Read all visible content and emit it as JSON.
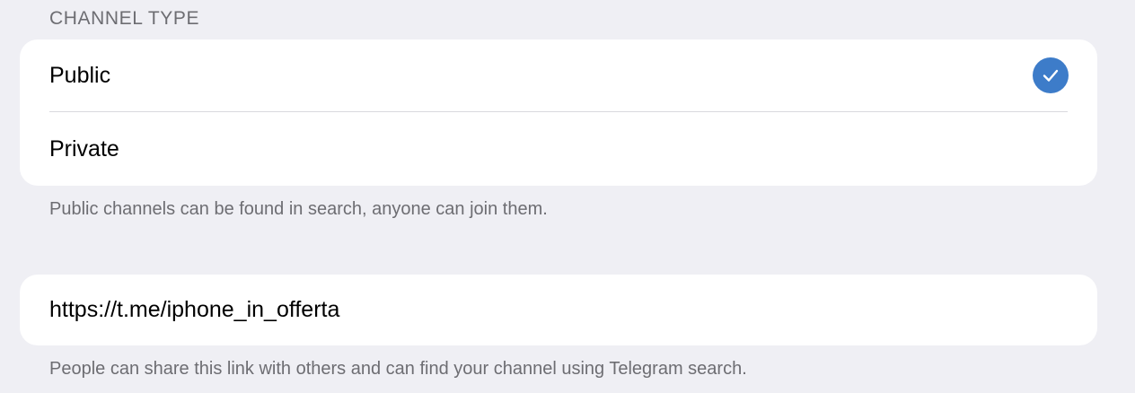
{
  "section": {
    "header": "CHANNEL TYPE"
  },
  "channel_type": {
    "options": [
      {
        "label": "Public",
        "selected": true
      },
      {
        "label": "Private",
        "selected": false
      }
    ],
    "footer": "Public channels can be found in search, anyone can join them."
  },
  "link": {
    "value": "https://t.me/iphone_in_offerta",
    "footer": "People can share this link with others and can find your channel using Telegram search."
  },
  "colors": {
    "accent": "#3d7cc9",
    "background": "#efeff4",
    "secondary_text": "#6d6d72"
  }
}
